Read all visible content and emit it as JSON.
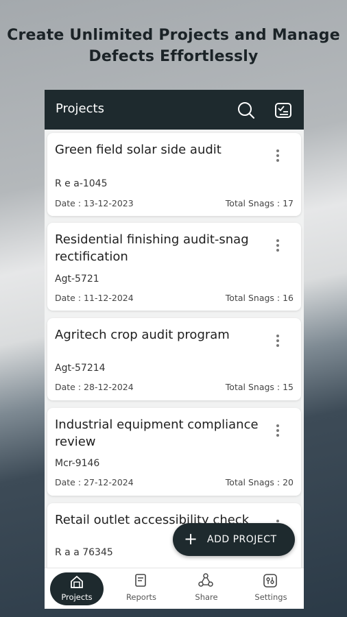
{
  "headline": [
    "Create Unlimited Projects and Manage",
    "Defects Effortlessly"
  ],
  "appbar": {
    "title": "Projects",
    "icons": [
      "search-icon",
      "checklist-icon"
    ]
  },
  "projects": [
    {
      "title": "Green field solar side audit",
      "code": "R e a-1045",
      "date": "Date : 13-12-2023",
      "snags": "Total Snags : 17"
    },
    {
      "title": "Residential finishing audit-snag rectification",
      "code": "Agt-5721",
      "date": "Date : 11-12-2024",
      "snags": "Total Snags : 16"
    },
    {
      "title": "Agritech crop audit program",
      "code": "Agt-57214",
      "date": "Date : 28-12-2024",
      "snags": "Total Snags : 15"
    },
    {
      "title": "Industrial equipment compliance review",
      "code": "Mcr-9146",
      "date": "Date : 27-12-2024",
      "snags": "Total Snags : 20"
    },
    {
      "title": "Retail outlet accessibility check",
      "code": "R a a 76345"
    }
  ],
  "fab": {
    "label": "ADD PROJECT",
    "icon": "plus-icon"
  },
  "bottom_nav": [
    {
      "label": "Projects",
      "icon": "house-icon",
      "active": true
    },
    {
      "label": "Reports",
      "icon": "report-icon"
    },
    {
      "label": "Share",
      "icon": "share-icon"
    },
    {
      "label": "Settings",
      "icon": "settings-icon"
    }
  ],
  "colors": {
    "dark": "#1e2a2e",
    "screen_bg": "#f1f2f2",
    "card": "#ffffff"
  }
}
